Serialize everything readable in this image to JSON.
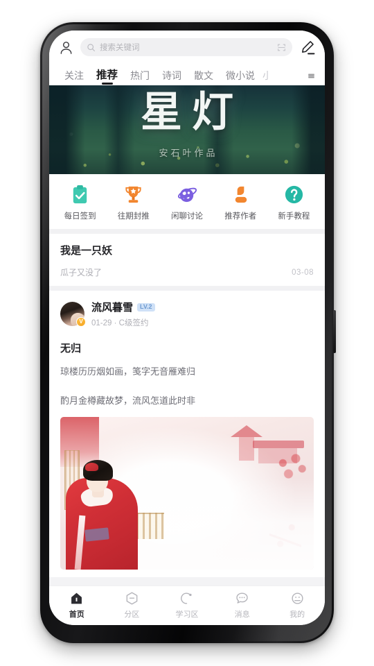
{
  "topbar": {
    "profile_icon": "user-avatar-icon",
    "search_placeholder": "搜索关键词",
    "search_icon": "search-icon",
    "scan_icon": "scan-code-icon",
    "edit_icon": "pencil-edit-icon"
  },
  "tabs": {
    "items": [
      {
        "label": "关注",
        "active": false
      },
      {
        "label": "推荐",
        "active": true
      },
      {
        "label": "热门",
        "active": false
      },
      {
        "label": "诗词",
        "active": false
      },
      {
        "label": "散文",
        "active": false
      },
      {
        "label": "微小说",
        "active": false
      },
      {
        "label": "小",
        "active": false
      }
    ],
    "menu_icon": "hamburger-menu-icon"
  },
  "banner": {
    "title": "星灯",
    "subtitle": "安石叶作品"
  },
  "quick_actions": [
    {
      "label": "每日签到",
      "icon": "clipboard-check-icon",
      "color": "#3fc9b0"
    },
    {
      "label": "往期封推",
      "icon": "trophy-icon",
      "color": "#f2862f"
    },
    {
      "label": "闲聊讨论",
      "icon": "planet-icon",
      "color": "#7b5fe0"
    },
    {
      "label": "推荐作者",
      "icon": "person-icon",
      "color": "#f2862f"
    },
    {
      "label": "新手教程",
      "icon": "question-circle-icon",
      "color": "#25b8a5"
    }
  ],
  "simple_post": {
    "title": "我是一只妖",
    "subtitle": "瓜子又没了",
    "date": "03-08"
  },
  "author_post": {
    "author_name": "流风暮雪",
    "level_badge": "LV.2",
    "verified_badge": "V",
    "date": "01-29",
    "separator": "·",
    "contract": "C级签约",
    "poem_title": "无归",
    "poem_lines": [
      "琼楼历历烟如画，笺字无音雁难归",
      "酌月金樽藏故梦，流风怎道此时非"
    ],
    "image_alt": "红衣女子倚栏水墨插画"
  },
  "bottom_nav": [
    {
      "label": "首页",
      "icon": "home-icon",
      "active": true
    },
    {
      "label": "分区",
      "icon": "hexagon-category-icon",
      "active": false
    },
    {
      "label": "学习区",
      "icon": "study-circle-icon",
      "active": false
    },
    {
      "label": "消息",
      "icon": "message-bubble-icon",
      "active": false
    },
    {
      "label": "我的",
      "icon": "profile-face-icon",
      "active": false
    }
  ]
}
